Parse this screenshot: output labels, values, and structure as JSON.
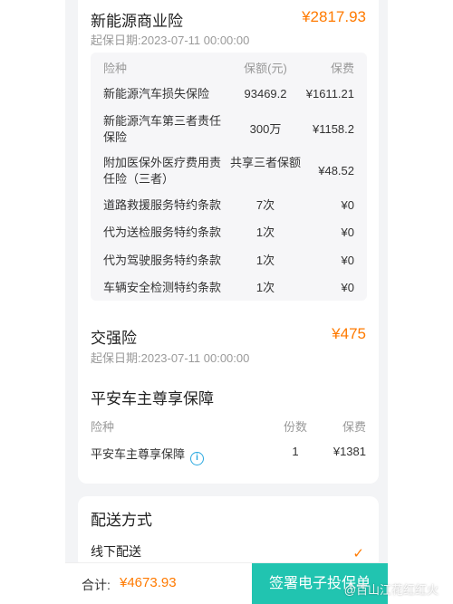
{
  "commercial": {
    "title": "新能源商业险",
    "price": "¥2817.93",
    "start_date": "起保日期:2023-07-11 00:00:00",
    "headers": [
      "险种",
      "保额(元)",
      "保费"
    ],
    "rows": [
      {
        "name": "新能源汽车损失保险",
        "amount": "93469.2",
        "fee": "¥1611.21"
      },
      {
        "name": "新能源汽车第三者责任保险",
        "amount": "300万",
        "fee": "¥1158.2"
      },
      {
        "name": "附加医保外医疗费用责任险（三者）",
        "amount": "共享三者保额",
        "fee": "¥48.52"
      },
      {
        "name": "道路救援服务特约条款",
        "amount": "7次",
        "fee": "¥0"
      },
      {
        "name": "代为送检服务特约条款",
        "amount": "1次",
        "fee": "¥0"
      },
      {
        "name": "代为驾驶服务特约条款",
        "amount": "1次",
        "fee": "¥0"
      },
      {
        "name": "车辆安全检测特约条款",
        "amount": "1次",
        "fee": "¥0"
      }
    ]
  },
  "compulsory": {
    "title": "交强险",
    "price": "¥475",
    "start_date": "起保日期:2023-07-11 00:00:00"
  },
  "guarantee": {
    "title": "平安车主尊享保障",
    "headers": [
      "险种",
      "份数",
      "保费"
    ],
    "rows": [
      {
        "name": "平安车主尊享保障",
        "count": "1",
        "fee": "¥1381"
      }
    ]
  },
  "delivery": {
    "title": "配送方式",
    "option": "线下配送"
  },
  "footer": {
    "total_label": "合计:",
    "total_value": "¥4673.93",
    "sign_button": "签署电子投保单",
    "watermark": "@百山江花红红火"
  },
  "icons": {
    "info": "info-icon",
    "check": "check-icon"
  }
}
